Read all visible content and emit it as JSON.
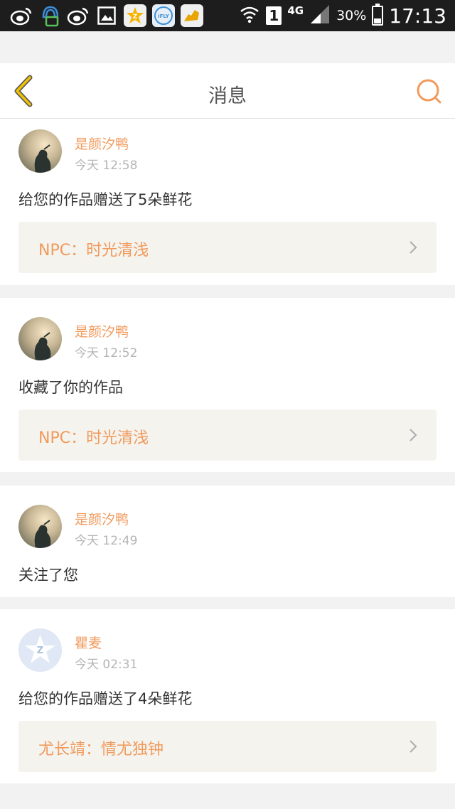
{
  "status_bar": {
    "network": "4G",
    "sim": "1",
    "battery": "30%",
    "battery_level": 0.3,
    "time": "17:13"
  },
  "header": {
    "title": "消息"
  },
  "notifications": [
    {
      "user": "是颜汐鸭",
      "time": "今天 12:58",
      "message": "给您的作品赠送了5朵鲜花",
      "work": "NPC：时光清浅"
    },
    {
      "user": "是颜汐鸭",
      "time": "今天 12:52",
      "message": "收藏了你的作品",
      "work": "NPC：时光清浅"
    },
    {
      "user": "是颜汐鸭",
      "time": "今天 12:49",
      "message": "关注了您"
    },
    {
      "user": "瞿麦",
      "time": "今天 02:31",
      "message": "给您的作品赠送了4朵鲜花",
      "work": "尤长靖：情尤独钟"
    }
  ],
  "colors": {
    "accent": "#f19a5c",
    "back_arrow": "#f2c200",
    "card_background": "#f4f3ee"
  }
}
